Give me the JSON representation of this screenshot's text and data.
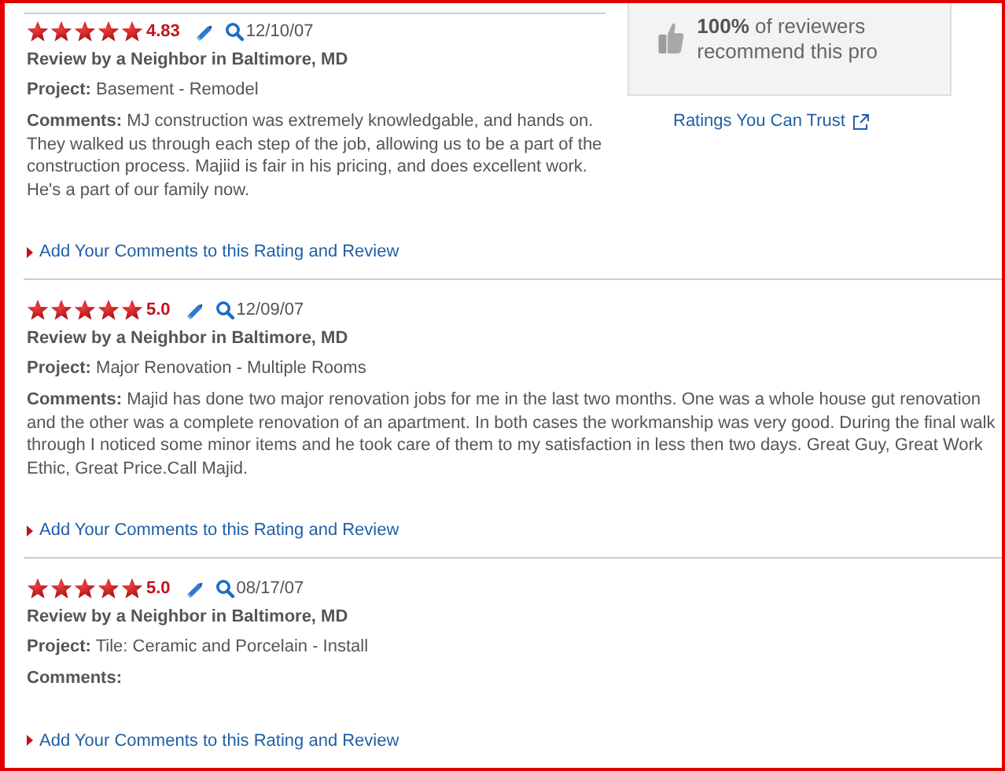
{
  "sidebar": {
    "recommend": "**100%** of reviewers recommend this pro",
    "trust_link": "Ratings You Can Trust"
  },
  "reviews": [
    {
      "stars": 5,
      "score": "4.83",
      "date": "12/10/07",
      "reviewer": "Review by a Neighbor in Baltimore, MD",
      "project": "**Project:** Basement - Remodel",
      "comments": "**Comments:** MJ construction was extremely knowledgable, and hands on. They walked us through each step of the job, allowing us to be a part of the construction process. Majiid is fair in his pricing, and does excellent work. He's a part of our family now.",
      "add_link": "Add Your Comments to this Rating and Review"
    },
    {
      "stars": 5,
      "score": "5.0",
      "date": "12/09/07",
      "reviewer": "Review by a Neighbor in Baltimore, MD",
      "project": "**Project:** Major Renovation - Multiple Rooms",
      "comments": "**Comments:** Majid has done two major renovation jobs for me in the last two months. One was a whole house gut renovation and the other was a complete renovation of an apartment. In both cases the workmanship was very good. During the final walk through I noticed some minor items and he took care of them to my satisfaction in less then two days. Great Guy, Great Work Ethic, Great Price.Call Majid.",
      "add_link": "Add Your Comments to this Rating and Review"
    },
    {
      "stars": 5,
      "score": "5.0",
      "date": "08/17/07",
      "reviewer": "Review by a Neighbor in Baltimore, MD",
      "project": "**Project:** Tile: Ceramic and Porcelain - Install",
      "comments": "**Comments:**",
      "add_link": "Add Your Comments to this Rating and Review"
    }
  ]
}
